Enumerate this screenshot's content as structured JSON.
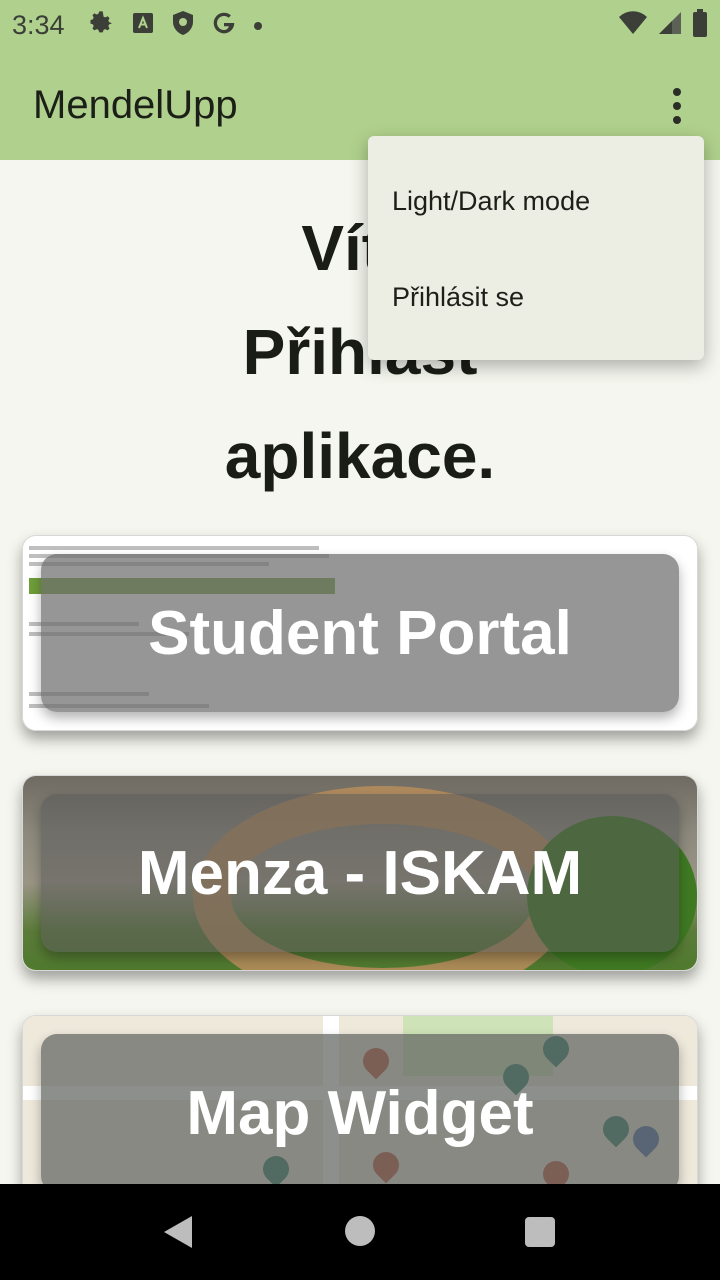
{
  "status_bar": {
    "time": "3:34",
    "icons_left": [
      "gear-icon",
      "a-icon",
      "shield-icon",
      "google-g-icon",
      "dot-icon"
    ],
    "icons_right": [
      "wifi-icon",
      "signal-icon",
      "battery-icon"
    ]
  },
  "app_bar": {
    "title": "MendelUpp",
    "overflow_icon": "more-vertical-icon"
  },
  "welcome": {
    "line1": "Víte",
    "line2": "Přihlašt",
    "line3": "aplikace."
  },
  "cards": [
    {
      "label": "Student Portal"
    },
    {
      "label": "Menza - ISKAM"
    },
    {
      "label": "Map Widget"
    }
  ],
  "menu": {
    "items": [
      {
        "label": "Light/Dark mode"
      },
      {
        "label": "Přihlásit se"
      }
    ]
  },
  "nav_bar": {
    "icons": [
      "back-icon",
      "home-icon",
      "recents-icon"
    ]
  },
  "colors": {
    "accent": "#b0d18d",
    "background": "#f5f6ef",
    "menu_background": "#ecede3"
  }
}
